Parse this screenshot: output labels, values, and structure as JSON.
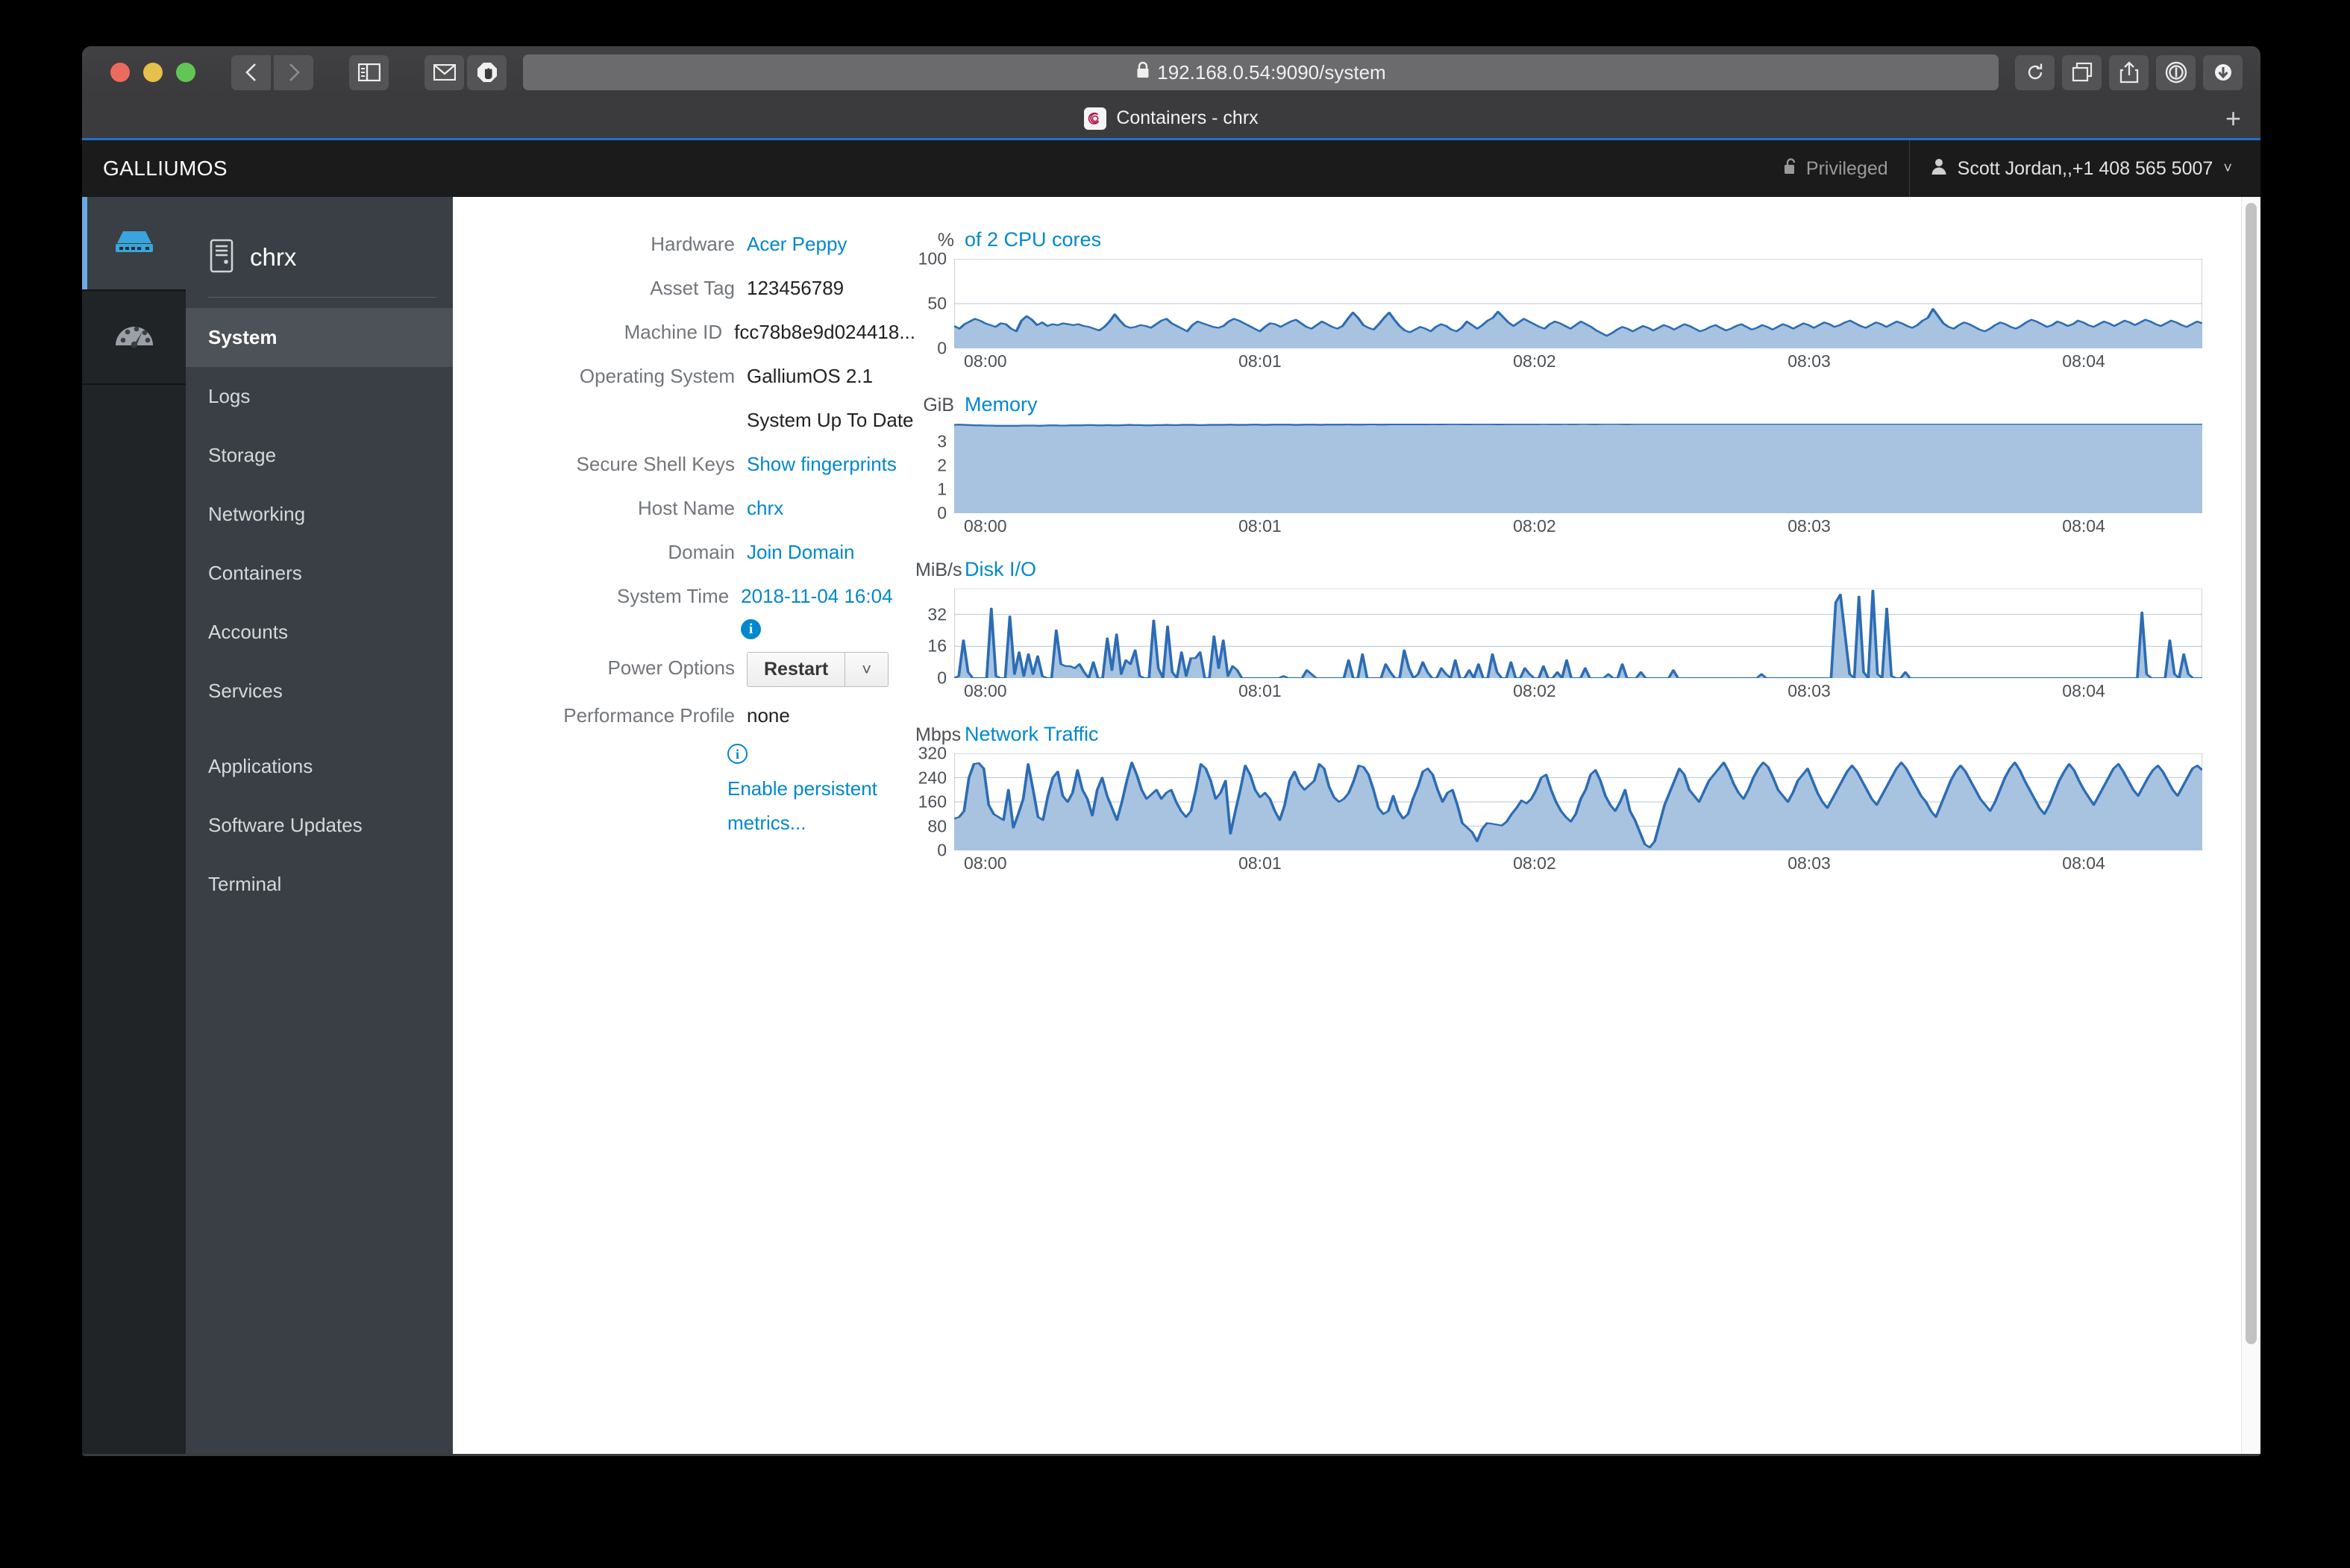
{
  "browser": {
    "window_controls": [
      "close",
      "minimize",
      "maximize"
    ],
    "back_label": "‹",
    "forward_label": "›",
    "sidebar_toggle_name": "sidebar-toggle",
    "mail_icon": "mail-icon",
    "adblock_icon": "adblock-stop-icon",
    "url": "192.168.0.54:9090/system",
    "lock": "🔒",
    "reload_icon": "reload-icon",
    "tabs_icon": "tab-overview-icon",
    "share_icon": "share-icon",
    "onepassword_icon": "1password-icon",
    "download_icon": "download-icon",
    "tab_title": "Containers - chrx",
    "new_tab_label": "+"
  },
  "cockpit": {
    "brand": "GALLIUMOS",
    "privileged_label": "Privileged",
    "user_label": "Scott Jordan,,+1 408 565 5007",
    "caret": "˅",
    "rail": [
      {
        "name": "server-item",
        "icon": "server-icon",
        "active": true
      },
      {
        "name": "dashboard-item",
        "icon": "dashboard-gauge-icon",
        "active": false
      }
    ],
    "host_name": "chrx",
    "host_icon": "computer-tower-icon",
    "nav": [
      {
        "label": "System",
        "active": true
      },
      {
        "label": "Logs",
        "active": false
      },
      {
        "label": "Storage",
        "active": false
      },
      {
        "label": "Networking",
        "active": false
      },
      {
        "label": "Containers",
        "active": false
      },
      {
        "label": "Accounts",
        "active": false
      },
      {
        "label": "Services",
        "active": false
      },
      {
        "label": "Applications",
        "active": false,
        "gap_before": true
      },
      {
        "label": "Software Updates",
        "active": false
      },
      {
        "label": "Terminal",
        "active": false
      }
    ]
  },
  "system_info": {
    "hardware_label": "Hardware",
    "hardware_value": "Acer Peppy",
    "asset_tag_label": "Asset Tag",
    "asset_tag_value": "123456789",
    "machine_id_label": "Machine ID",
    "machine_id_value": "fcc78b8e9d024418...",
    "os_label": "Operating System",
    "os_value": "GalliumOS 2.1",
    "update_status": "System Up To Date",
    "ssh_label": "Secure Shell Keys",
    "ssh_value": "Show fingerprints",
    "host_label": "Host Name",
    "host_value": "chrx",
    "domain_label": "Domain",
    "domain_value": "Join Domain",
    "time_label": "System Time",
    "time_value": "2018-11-04 16:04",
    "time_info_icon": "info-icon",
    "power_label": "Power Options",
    "power_button": "Restart",
    "power_caret": "˅",
    "profile_label": "Performance Profile",
    "profile_value": "none",
    "persist_icon": "info-outline-icon",
    "persist_link": "Enable persistent metrics..."
  },
  "colors": {
    "accent_link": "#0088ce",
    "chart_line": "#2c6cb4",
    "chart_fill": "#a7c3e0",
    "header_bg": "#1b1b1b",
    "sidebar_bg": "#393f44",
    "rail_accent": "#6aaae4"
  },
  "chart_data": [
    {
      "type": "area",
      "title": "of 2 CPU cores",
      "ylabel": "%",
      "ylim": [
        0,
        100
      ],
      "yticks": [
        0,
        50,
        100
      ],
      "xticks": [
        "08:00",
        "08:01",
        "08:02",
        "08:03",
        "08:04"
      ],
      "grid": true,
      "values": [
        25,
        22,
        27,
        30,
        33,
        31,
        28,
        26,
        24,
        28,
        27,
        22,
        19,
        31,
        36,
        32,
        26,
        29,
        25,
        27,
        26,
        28,
        27,
        26,
        27,
        25,
        24,
        22,
        20,
        24,
        30,
        38,
        31,
        25,
        23,
        24,
        26,
        25,
        23,
        27,
        31,
        33,
        28,
        25,
        22,
        19,
        26,
        30,
        28,
        26,
        24,
        23,
        25,
        30,
        33,
        31,
        28,
        25,
        22,
        19,
        24,
        28,
        27,
        24,
        27,
        30,
        32,
        28,
        24,
        22,
        26,
        30,
        27,
        24,
        22,
        25,
        33,
        40,
        34,
        26,
        23,
        21,
        27,
        34,
        40,
        32,
        25,
        20,
        18,
        21,
        24,
        22,
        19,
        24,
        27,
        25,
        21,
        19,
        23,
        30,
        26,
        22,
        26,
        31,
        34,
        41,
        35,
        29,
        25,
        29,
        33,
        30,
        27,
        24,
        22,
        27,
        30,
        28,
        25,
        22,
        26,
        30,
        27,
        24,
        20,
        17,
        14,
        17,
        21,
        24,
        22,
        19,
        22,
        25,
        23,
        20,
        23,
        26,
        24,
        21,
        24,
        27,
        25,
        22,
        19,
        21,
        24,
        26,
        23,
        20,
        22,
        25,
        27,
        24,
        21,
        23,
        26,
        24,
        21,
        24,
        27,
        25,
        22,
        25,
        28,
        26,
        23,
        26,
        29,
        27,
        24,
        26,
        29,
        31,
        28,
        25,
        23,
        26,
        29,
        27,
        24,
        27,
        30,
        28,
        25,
        23,
        26,
        31,
        34,
        44,
        36,
        28,
        24,
        22,
        26,
        29,
        27,
        24,
        21,
        19,
        22,
        26,
        29,
        27,
        24,
        22,
        25,
        29,
        32,
        30,
        27,
        24,
        26,
        30,
        28,
        25,
        27,
        31,
        29,
        26,
        24,
        27,
        30,
        28,
        25,
        28,
        31,
        29,
        26,
        29,
        32,
        30,
        27,
        25,
        28,
        31,
        29,
        26,
        24,
        27,
        30,
        28
      ]
    },
    {
      "type": "area",
      "title": "Memory",
      "ylabel": "GiB",
      "ylim": [
        0,
        3.75
      ],
      "yticks": [
        0,
        1,
        2,
        3
      ],
      "xticks": [
        "08:00",
        "08:01",
        "08:02",
        "08:03",
        "08:04"
      ],
      "grid": true,
      "values": [
        3.7,
        3.71,
        3.7,
        3.69,
        3.68,
        3.68,
        3.67,
        3.67,
        3.66,
        3.66,
        3.66,
        3.66,
        3.66,
        3.67,
        3.67,
        3.67,
        3.66,
        3.67,
        3.68,
        3.68,
        3.67,
        3.67,
        3.68,
        3.68,
        3.68,
        3.69,
        3.69,
        3.68,
        3.68,
        3.69,
        3.68,
        3.68,
        3.69,
        3.7,
        3.69,
        3.69,
        3.68,
        3.68,
        3.69,
        3.69,
        3.7,
        3.69,
        3.69,
        3.7,
        3.7,
        3.7,
        3.69,
        3.69,
        3.7,
        3.7,
        3.7,
        3.7,
        3.71,
        3.7,
        3.7,
        3.7,
        3.71,
        3.71,
        3.7,
        3.7,
        3.71,
        3.71,
        3.71,
        3.71,
        3.7,
        3.7,
        3.71,
        3.71,
        3.71,
        3.7,
        3.71,
        3.71,
        3.71,
        3.71,
        3.72,
        3.71,
        3.71,
        3.71,
        3.72,
        3.72,
        3.71,
        3.71,
        3.72,
        3.72,
        3.72,
        3.72,
        3.72,
        3.72,
        3.72,
        3.72,
        3.73,
        3.72,
        3.72,
        3.73,
        3.73,
        3.73,
        3.72,
        3.72,
        3.73,
        3.73,
        3.73,
        3.73,
        3.72,
        3.72,
        3.73,
        3.73,
        3.73,
        3.73,
        3.73,
        3.73,
        3.73,
        3.74,
        3.73,
        3.73,
        3.73,
        3.74,
        3.73,
        3.73,
        3.74,
        3.74,
        3.73,
        3.73,
        3.74,
        3.74,
        3.74,
        3.74,
        3.73,
        3.73,
        3.74,
        3.74,
        3.74,
        3.74,
        3.74,
        3.74,
        3.74,
        3.74,
        3.74,
        3.74,
        3.74,
        3.74,
        3.74,
        3.74,
        3.74,
        3.74,
        3.74,
        3.74,
        3.74,
        3.74,
        3.74,
        3.74,
        3.74,
        3.74,
        3.74,
        3.74,
        3.74,
        3.74,
        3.74,
        3.74,
        3.74,
        3.74,
        3.74,
        3.74,
        3.74,
        3.74,
        3.74,
        3.74,
        3.74,
        3.74,
        3.74,
        3.74,
        3.74,
        3.74,
        3.74,
        3.74,
        3.74,
        3.74,
        3.74,
        3.74,
        3.74,
        3.74,
        3.74,
        3.74,
        3.74,
        3.74,
        3.74,
        3.74,
        3.74,
        3.74,
        3.74,
        3.74,
        3.74,
        3.74,
        3.74,
        3.74,
        3.74,
        3.74,
        3.74,
        3.74,
        3.74,
        3.74,
        3.74,
        3.74,
        3.74,
        3.74,
        3.74,
        3.74,
        3.74,
        3.74,
        3.74,
        3.74,
        3.74,
        3.74,
        3.74,
        3.74,
        3.74,
        3.74,
        3.74,
        3.74,
        3.74,
        3.74,
        3.74,
        3.74,
        3.74,
        3.74,
        3.74,
        3.74,
        3.74,
        3.74,
        3.74,
        3.74,
        3.74,
        3.74,
        3.74,
        3.74,
        3.74,
        3.74
      ]
    },
    {
      "type": "area",
      "title": "Disk I/O",
      "ylabel": "MiB/s",
      "ylim": [
        0,
        45
      ],
      "yticks": [
        0,
        16,
        32
      ],
      "xticks": [
        "08:00",
        "08:01",
        "08:02",
        "08:03",
        "08:04"
      ],
      "grid": true,
      "values": [
        0,
        1,
        19,
        3,
        0,
        0,
        0,
        0,
        35,
        1,
        0,
        0,
        31,
        2,
        13,
        1,
        12,
        2,
        11,
        1,
        0,
        0,
        24,
        7,
        6,
        6,
        5,
        7,
        3,
        0,
        8,
        0,
        0,
        20,
        4,
        22,
        2,
        9,
        7,
        14,
        1,
        0,
        0,
        29,
        5,
        0,
        26,
        3,
        0,
        13,
        1,
        10,
        10,
        13,
        0,
        0,
        21,
        5,
        19,
        1,
        6,
        4,
        0,
        0,
        0,
        0,
        0,
        0,
        0,
        0,
        0,
        1,
        0,
        0,
        0,
        0,
        4,
        2,
        0,
        0,
        0,
        0,
        0,
        0,
        0,
        9,
        0,
        0,
        12,
        0,
        0,
        0,
        0,
        7,
        3,
        0,
        0,
        14,
        5,
        0,
        2,
        8,
        3,
        0,
        0,
        5,
        2,
        0,
        9,
        0,
        0,
        4,
        0,
        7,
        0,
        0,
        12,
        3,
        0,
        0,
        8,
        0,
        0,
        5,
        2,
        0,
        0,
        6,
        0,
        0,
        3,
        0,
        9,
        0,
        0,
        0,
        5,
        0,
        0,
        0,
        0,
        2,
        0,
        0,
        7,
        0,
        0,
        0,
        3,
        0,
        0,
        0,
        0,
        0,
        0,
        4,
        0,
        0,
        0,
        0,
        0,
        0,
        0,
        0,
        0,
        0,
        0,
        0,
        0,
        0,
        0,
        0,
        0,
        0,
        2,
        0,
        0,
        0,
        0,
        0,
        0,
        0,
        0,
        0,
        0,
        0,
        0,
        0,
        0,
        0,
        38,
        42,
        22,
        2,
        0,
        41,
        3,
        0,
        44,
        2,
        0,
        35,
        1,
        0,
        0,
        3,
        0,
        0,
        0,
        0,
        0,
        0,
        0,
        0,
        0,
        0,
        0,
        0,
        0,
        0,
        0,
        0,
        0,
        0,
        0,
        0,
        0,
        0,
        0,
        0,
        0,
        0,
        0,
        0,
        0,
        0,
        0,
        0,
        0,
        0,
        0,
        0,
        0,
        0,
        0,
        0,
        0,
        0,
        0,
        0,
        0,
        0,
        0,
        0,
        0,
        0,
        33,
        2,
        0,
        0,
        0,
        0,
        19,
        2,
        0,
        12,
        2,
        0,
        0,
        0
      ]
    },
    {
      "type": "area",
      "title": "Network Traffic",
      "ylabel": "Mbps",
      "ylim": [
        0,
        320
      ],
      "yticks": [
        0,
        80,
        160,
        240,
        320
      ],
      "xticks": [
        "08:00",
        "08:01",
        "08:02",
        "08:03",
        "08:04"
      ],
      "grid": true,
      "values": [
        105,
        110,
        130,
        240,
        285,
        288,
        270,
        150,
        120,
        110,
        100,
        200,
        75,
        120,
        170,
        285,
        200,
        110,
        100,
        180,
        240,
        260,
        180,
        160,
        190,
        265,
        200,
        170,
        115,
        200,
        240,
        180,
        140,
        100,
        160,
        230,
        290,
        250,
        200,
        170,
        185,
        200,
        170,
        190,
        200,
        160,
        130,
        110,
        130,
        200,
        285,
        270,
        230,
        170,
        190,
        230,
        55,
        130,
        200,
        280,
        250,
        200,
        175,
        190,
        170,
        130,
        100,
        150,
        230,
        260,
        220,
        200,
        215,
        230,
        285,
        270,
        210,
        175,
        160,
        170,
        190,
        230,
        280,
        275,
        250,
        200,
        140,
        120,
        130,
        180,
        130,
        105,
        120,
        170,
        210,
        260,
        270,
        250,
        200,
        160,
        190,
        200,
        150,
        90,
        75,
        60,
        30,
        70,
        90,
        88,
        85,
        82,
        95,
        120,
        140,
        165,
        155,
        170,
        200,
        240,
        250,
        200,
        160,
        130,
        110,
        95,
        120,
        170,
        200,
        250,
        265,
        230,
        180,
        150,
        130,
        160,
        200,
        130,
        100,
        60,
        20,
        10,
        30,
        90,
        150,
        190,
        230,
        270,
        250,
        200,
        180,
        160,
        195,
        230,
        250,
        270,
        290,
        260,
        220,
        190,
        170,
        200,
        240,
        270,
        290,
        275,
        240,
        200,
        180,
        160,
        190,
        230,
        250,
        270,
        230,
        190,
        160,
        140,
        170,
        200,
        230,
        260,
        280,
        260,
        230,
        200,
        170,
        150,
        180,
        210,
        240,
        270,
        290,
        270,
        240,
        210,
        180,
        160,
        130,
        110,
        150,
        190,
        230,
        260,
        280,
        260,
        230,
        200,
        170,
        150,
        130,
        160,
        200,
        240,
        270,
        290,
        265,
        230,
        200,
        170,
        140,
        120,
        150,
        190,
        230,
        260,
        285,
        265,
        230,
        200,
        175,
        150,
        180,
        210,
        240,
        270,
        285,
        260,
        230,
        200,
        180,
        210,
        240,
        265,
        280,
        260,
        230,
        200,
        180,
        210,
        240,
        270,
        280,
        265
      ]
    }
  ]
}
